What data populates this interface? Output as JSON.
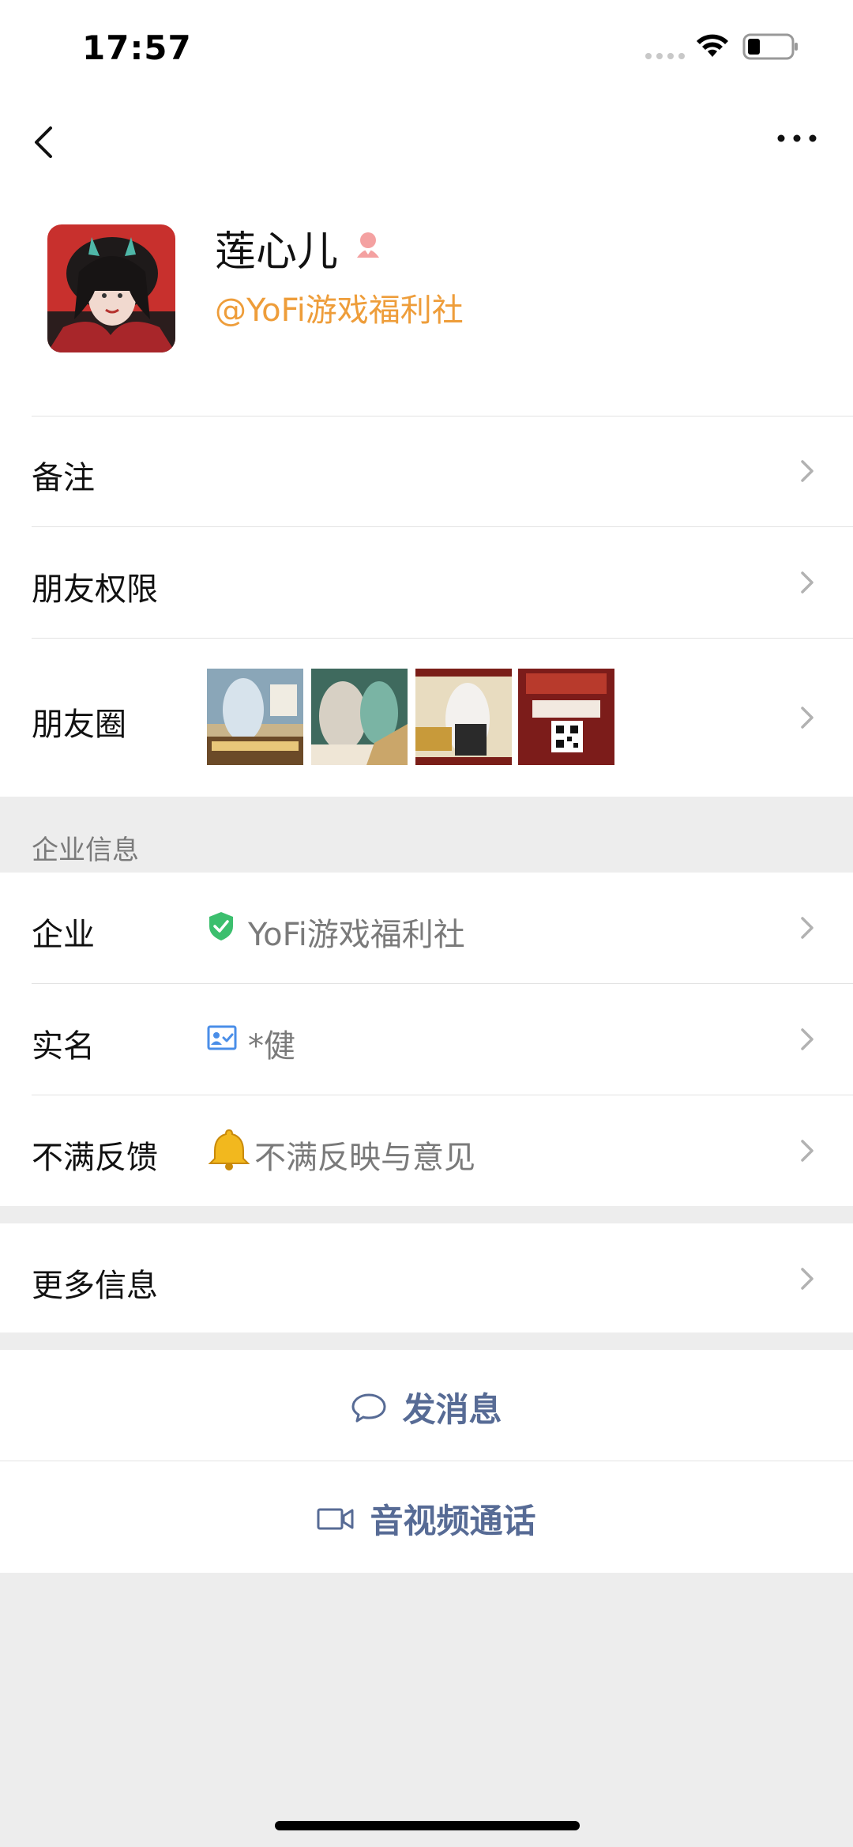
{
  "status_bar": {
    "time": "17:57"
  },
  "profile": {
    "name": "莲心儿",
    "org_handle": "@YoFi游戏福利社",
    "gender": "female"
  },
  "rows": {
    "remark": {
      "label": "备注"
    },
    "friend_permissions": {
      "label": "朋友权限"
    },
    "moments": {
      "label": "朋友圈",
      "thumbnail_count": 4
    }
  },
  "enterprise_section": {
    "caption": "企业信息",
    "company": {
      "label": "企业",
      "value": "YoFi游戏福利社",
      "icon": "verified-shield-icon"
    },
    "real_name": {
      "label": "实名",
      "value": "*健",
      "icon": "id-card-icon"
    },
    "complaint": {
      "label": "不满反馈",
      "value": "不满反映与意见",
      "icon": "bell-icon"
    }
  },
  "more_info": {
    "label": "更多信息"
  },
  "actions": {
    "send_message": {
      "label": "发消息",
      "icon": "chat-bubble-icon"
    },
    "video_call": {
      "label": "音视频通话",
      "icon": "video-camera-icon"
    }
  },
  "colors": {
    "accent_link": "#576b95",
    "org_handle": "#ee9d3a",
    "verified": "#3cbf6e",
    "background": "#ededed"
  }
}
